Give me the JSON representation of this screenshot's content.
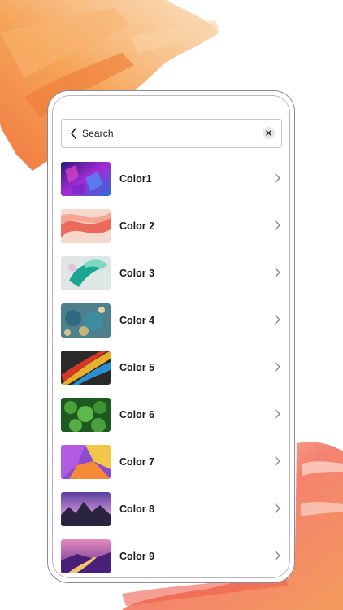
{
  "search": {
    "placeholder": "Search",
    "back_icon": "chevron-left-icon",
    "clear_icon": "close-icon"
  },
  "items": [
    {
      "label": "Color1",
      "thumbnail": "purple-blue-crystal-texture"
    },
    {
      "label": "Color 2",
      "thumbnail": "coral-silk-swirls"
    },
    {
      "label": "Color 3",
      "thumbnail": "teal-paint-splash"
    },
    {
      "label": "Color 4",
      "thumbnail": "blue-gold-orbs"
    },
    {
      "label": "Color 5",
      "thumbnail": "rainbow-feathers"
    },
    {
      "label": "Color 6",
      "thumbnail": "green-clover-leaves"
    },
    {
      "label": "Color 7",
      "thumbnail": "purple-yellow-geometric"
    },
    {
      "label": "Color 8",
      "thumbnail": "mountain-sunset"
    },
    {
      "label": "Color 9",
      "thumbnail": "purple-road-landscape"
    }
  ],
  "colors": {
    "accent_stroke_top": "#f39a4a",
    "accent_stroke_bottom": "#f26a5a",
    "frame_border": "#8c8797",
    "chevron": "#8a8a8e"
  }
}
